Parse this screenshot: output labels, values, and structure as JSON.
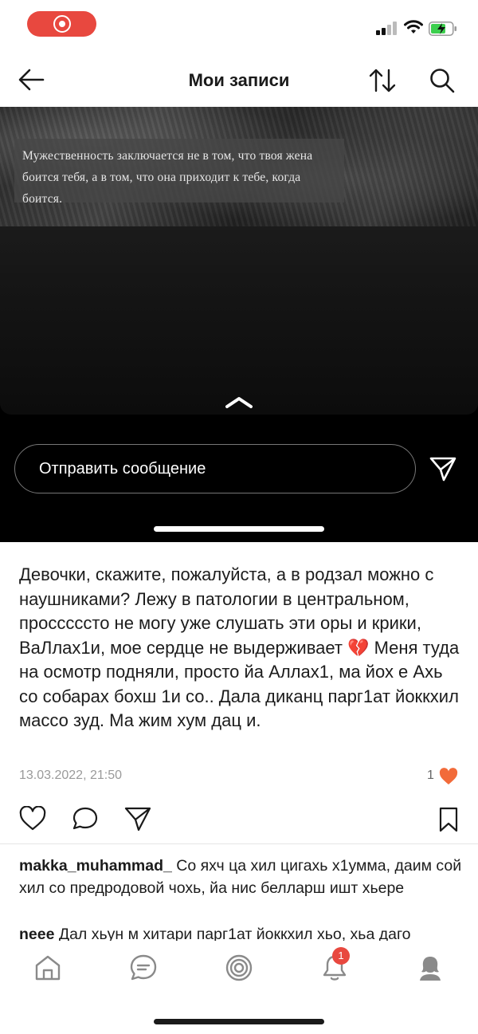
{
  "header": {
    "title": "Мои записи"
  },
  "story": {
    "quote": "Мужественность заключается не в том, что твоя жена боится тебя, а в том, что она приходит к тебе, когда боится.",
    "message_placeholder": "Отправить сообщение"
  },
  "post": {
    "text": "Девочки, скажите, пожалуйста, а в родзал можно с наушниками? Лежу в патологии в центральном, просссссто не могу уже слушать эти оры и крики, ВаЛлах1и, мое сердце не выдерживает 💔 Меня туда на осмотр подняли, просто йа Аллах1, ма йох е Ахь со собарах бохш 1и со.. Дала диканц парг1ат йоккхил массо зуд. Ма жим хум дац и.",
    "timestamp": "13.03.2022, 21:50",
    "likes": "1",
    "accent_color": "#f26b3a"
  },
  "comments": [
    {
      "author": "makka_muhammad_",
      "text": "Со яхч ца хил цигахь х1умма, даим сой хил со предродовой чохь, йа нис белларш ишт хьере"
    },
    {
      "author": "neee",
      "text": "Дал хьун м хитари парг1ат йоккхил хьо, хьа даго"
    }
  ],
  "nav": {
    "notifications_badge": "1",
    "items": [
      "home-icon",
      "chat-icon",
      "target-icon",
      "bell-icon",
      "profile-icon"
    ]
  }
}
